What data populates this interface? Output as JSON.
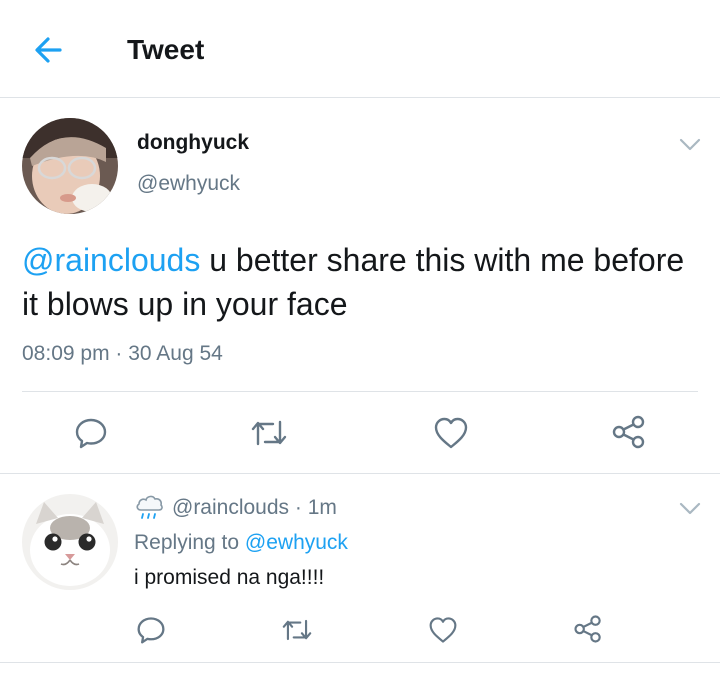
{
  "header": {
    "title": "Tweet",
    "back_icon": "arrow-left-icon",
    "accent": "#1da1f2"
  },
  "tweet": {
    "name": "donghyuck",
    "handle": "@ewhyuck",
    "mention": "@rainclouds",
    "text": " u better share this with me before it blows up in your face",
    "time": "08:09 pm",
    "separator": "·",
    "date": "30 Aug 54",
    "actions": [
      "reply-icon",
      "retweet-icon",
      "like-icon",
      "share-icon"
    ]
  },
  "reply": {
    "emoji": "rain-cloud-icon",
    "handle": "@rainclouds",
    "time": "· 1m",
    "replying_prefix": "Replying to",
    "replying_to": "@ewhyuck",
    "text": "i promised na nga!!!!",
    "actions": [
      "reply-icon",
      "retweet-icon",
      "like-icon",
      "share-icon"
    ]
  },
  "colors": {
    "text": "#14171a",
    "secondary": "#657786",
    "link": "#1da1f2",
    "border": "#dfe3e7"
  }
}
